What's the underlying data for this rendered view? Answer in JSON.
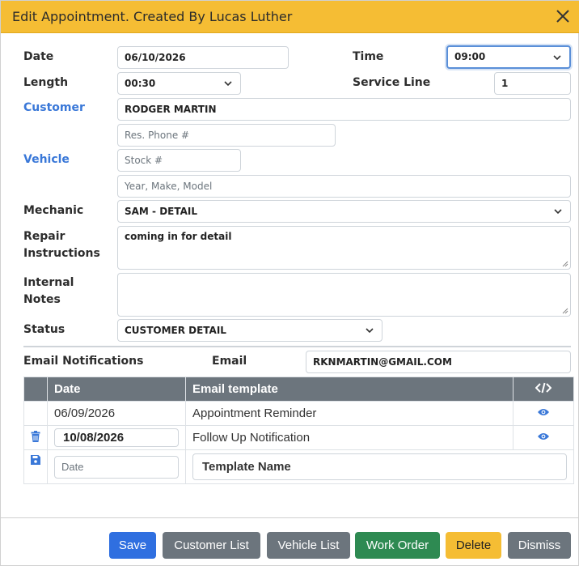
{
  "header": {
    "title": "Edit Appointment. Created By Lucas Luther"
  },
  "form": {
    "date_label": "Date",
    "date_value": "06/10/2026",
    "time_label": "Time",
    "time_value": "09:00",
    "length_label": "Length",
    "length_value": "00:30",
    "service_line_label": "Service Line",
    "service_line_value": "1",
    "customer_label": "Customer",
    "customer_name": "RODGER  MARTIN",
    "res_phone_placeholder": "Res. Phone #",
    "vehicle_label": "Vehicle",
    "stock_placeholder": "Stock #",
    "ymm_placeholder": "Year, Make, Model",
    "mechanic_label": "Mechanic",
    "mechanic_value": "SAM - DETAIL",
    "repair_label_1": "Repair",
    "repair_label_2": "Instructions",
    "repair_value": "coming in for detail",
    "notes_label_1": "Internal",
    "notes_label_2": "Notes",
    "notes_value": "",
    "status_label": "Status",
    "status_value": "CUSTOMER DETAIL",
    "email_notifications_label": "Email Notifications",
    "email_label": "Email",
    "email_value": "RKNMARTIN@GMAIL.COM"
  },
  "notifications": {
    "col_date": "Date",
    "col_template": "Email template",
    "rows": [
      {
        "date": "06/09/2026",
        "template": "Appointment Reminder"
      },
      {
        "date": "10/08/2026",
        "template": "Follow Up Notification"
      }
    ],
    "new_date_placeholder": "Date",
    "new_template_placeholder": "Template Name"
  },
  "footer": {
    "save": "Save",
    "customer_list": "Customer List",
    "vehicle_list": "Vehicle List",
    "work_order": "Work Order",
    "delete": "Delete",
    "dismiss": "Dismiss"
  },
  "colors": {
    "header": "#f5bd34",
    "primary": "#2f6fe0",
    "secondary": "#6c757d",
    "success": "#2e8a52",
    "warning": "#f5bd34",
    "link_label": "#3a78d8"
  }
}
